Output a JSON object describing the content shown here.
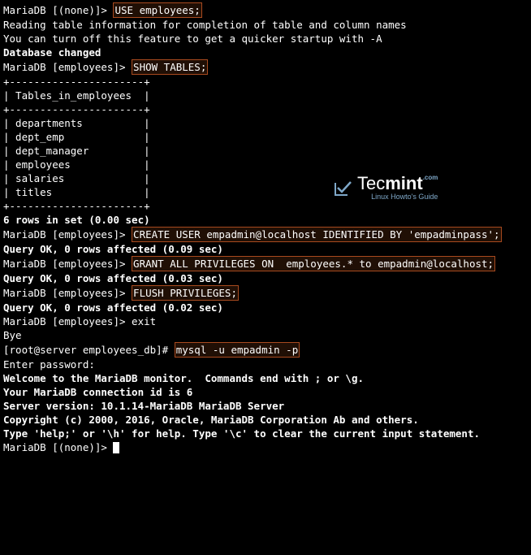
{
  "logo": {
    "main_left": "Tec",
    "main_right": "mint",
    "dotcom": ".com",
    "sub": "Linux Howto's Guide"
  },
  "lines": {
    "l1_prompt": "MariaDB [(none)]> ",
    "l1_cmd": "USE employees;",
    "l2": "Reading table information for completion of table and column names",
    "l3": "You can turn off this feature to get a quicker startup with -A",
    "l4": "",
    "l5": "Database changed",
    "l6_prompt": "MariaDB [employees]> ",
    "l6_cmd": "SHOW TABLES;",
    "l7": "+----------------------+",
    "l8": "| Tables_in_employees  |",
    "l9": "+----------------------+",
    "l10": "| departments          |",
    "l11": "| dept_emp             |",
    "l12": "| dept_manager         |",
    "l13": "| employees            |",
    "l14": "| salaries             |",
    "l15": "| titles               |",
    "l16": "+----------------------+",
    "l17": "6 rows in set (0.00 sec)",
    "l18": "",
    "l19_prompt": "MariaDB [employees]> ",
    "l19_cmd": "CREATE USER empadmin@localhost IDENTIFIED BY 'empadminpass';",
    "l20": "Query OK, 0 rows affected (0.09 sec)",
    "l21": "",
    "l22_prompt": "MariaDB [employees]> ",
    "l22_cmd": "GRANT ALL PRIVILEGES ON  employees.* to empadmin@localhost;",
    "l23": "Query OK, 0 rows affected (0.03 sec)",
    "l24": "",
    "l25_prompt": "MariaDB [employees]> ",
    "l25_cmd": "FLUSH PRIVILEGES;",
    "l26": "Query OK, 0 rows affected (0.02 sec)",
    "l27": "",
    "l28": "MariaDB [employees]> exit",
    "l29": "Bye",
    "l30_prompt": "[root@server employees_db]# ",
    "l30_cmd": "mysql -u empadmin -p",
    "l31": "Enter password:",
    "l32": "Welcome to the MariaDB monitor.  Commands end with ; or \\g.",
    "l33": "Your MariaDB connection id is 6",
    "l34": "Server version: 10.1.14-MariaDB MariaDB Server",
    "l35": "",
    "l36": "Copyright (c) 2000, 2016, Oracle, MariaDB Corporation Ab and others.",
    "l37": "",
    "l38": "Type 'help;' or '\\h' for help. Type '\\c' to clear the current input statement.",
    "l39": "",
    "l40": "MariaDB [(none)]> "
  }
}
